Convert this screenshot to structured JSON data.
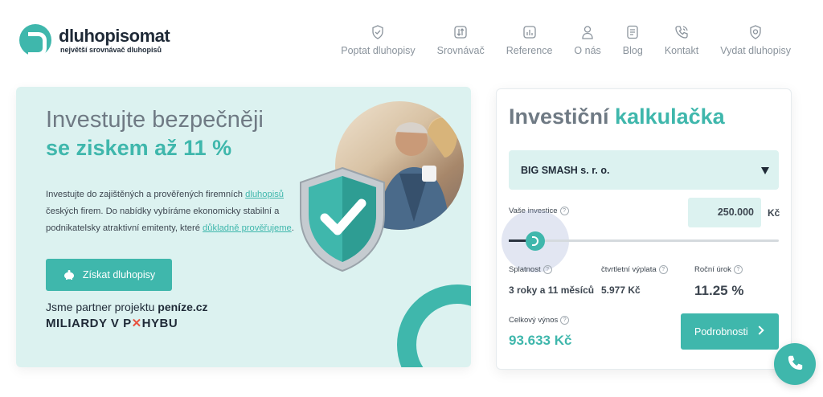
{
  "brand": {
    "name": "dluhopisomat",
    "tagline": "největší srovnávač dluhopisů",
    "accent_color": "#3fb7ac"
  },
  "nav": [
    {
      "label": "Poptat dluhopisy",
      "icon": "shield-check-icon"
    },
    {
      "label": "Srovnávač",
      "icon": "compare-arrows-icon"
    },
    {
      "label": "Reference",
      "icon": "bar-chart-icon"
    },
    {
      "label": "O nás",
      "icon": "user-icon"
    },
    {
      "label": "Blog",
      "icon": "document-icon"
    },
    {
      "label": "Kontakt",
      "icon": "phone-icon"
    },
    {
      "label": "Vydat dluhopisy",
      "icon": "shield-badge-icon"
    }
  ],
  "hero": {
    "title": "Investujte bezpečněji",
    "title_accent": "se ziskem až 11 %",
    "desc_1": "Investujte do zajištěných a prověřených firemních ",
    "desc_link_1": "dluhopisů",
    "desc_2": " českých firem. Do nabídky vybíráme ekonomicky stabilní a podnikatelsky atraktivní emitenty, které ",
    "desc_link_2": "důkladně prověřujeme",
    "desc_3": ".",
    "cta_label": "Získat dluhopisy",
    "partner_prefix": "Jsme partner projektu ",
    "partner_name": "peníze.cz",
    "miliardy_1": "MILIARDY V P",
    "miliardy_mark": "✕",
    "miliardy_2": "HYBU"
  },
  "calculator": {
    "title": "Investiční ",
    "title_accent": "kalkulačka",
    "selected_issuer": "BIG SMASH s. r. o.",
    "investment_label": "Vaše investice",
    "investment_value": "250.000",
    "currency": "Kč",
    "help_mark": "?",
    "maturity_label": "Splatnost",
    "maturity_value": "3 roky a 11 měsíců",
    "quarterly_label": "čtvrtletní výplata",
    "quarterly_value": "5.977 Kč",
    "annual_rate_label": "Roční úrok",
    "annual_rate_value": "11.25 %",
    "total_yield_label": "Celkový výnos",
    "total_yield_value": "93.633 Kč",
    "details_label": "Podrobnosti"
  }
}
